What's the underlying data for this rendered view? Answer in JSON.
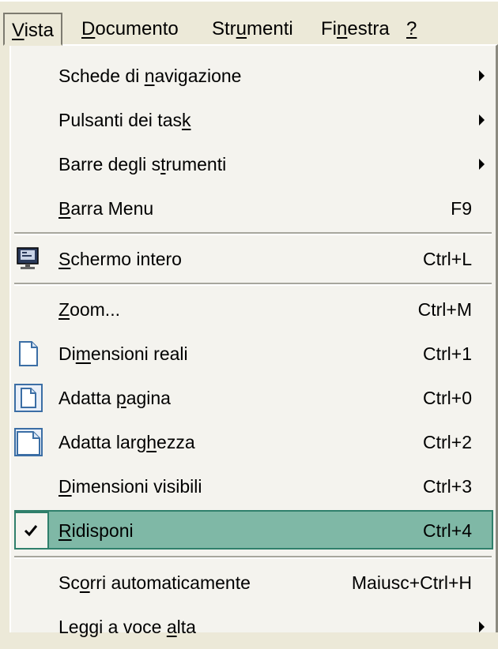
{
  "menubar": {
    "items": [
      {
        "label": "Vista",
        "accel": "V",
        "active": true
      },
      {
        "label": "Documento",
        "accel": "D"
      },
      {
        "label": "Strumenti",
        "accel": "u"
      },
      {
        "label": "Finestra",
        "accel": "n"
      },
      {
        "label": "?",
        "accel": "?"
      }
    ]
  },
  "menu": {
    "items": [
      {
        "label": "Schede di navigazione",
        "submenu": true
      },
      {
        "label": "Pulsanti dei task",
        "submenu": true
      },
      {
        "label": "Barre degli strumenti",
        "submenu": true
      },
      {
        "label": "Barra Menu",
        "shortcut": "F9"
      },
      {
        "label": "Schermo intero",
        "shortcut": "Ctrl+L",
        "icon": "fullscreen-icon"
      },
      {
        "label": "Zoom...",
        "shortcut": "Ctrl+M"
      },
      {
        "label": "Dimensioni reali",
        "shortcut": "Ctrl+1",
        "icon": "page-icon"
      },
      {
        "label": "Adatta pagina",
        "shortcut": "Ctrl+0",
        "icon": "fit-page-icon"
      },
      {
        "label": "Adatta larghezza",
        "shortcut": "Ctrl+2",
        "icon": "fit-width-icon"
      },
      {
        "label": "Dimensioni visibili",
        "shortcut": "Ctrl+3"
      },
      {
        "label": "Ridisponi",
        "shortcut": "Ctrl+4",
        "checked": true,
        "selected": true
      },
      {
        "label": "Scorri automaticamente",
        "shortcut": "Maiusc+Ctrl+H"
      },
      {
        "label": "Leggi a voce alta",
        "submenu": true
      }
    ]
  },
  "colors": {
    "menu_bg": "#f4f3ee",
    "selection_bg": "#7fb8a6",
    "selection_border": "#2f7f6b",
    "menubar_bg": "#ece9d8"
  }
}
